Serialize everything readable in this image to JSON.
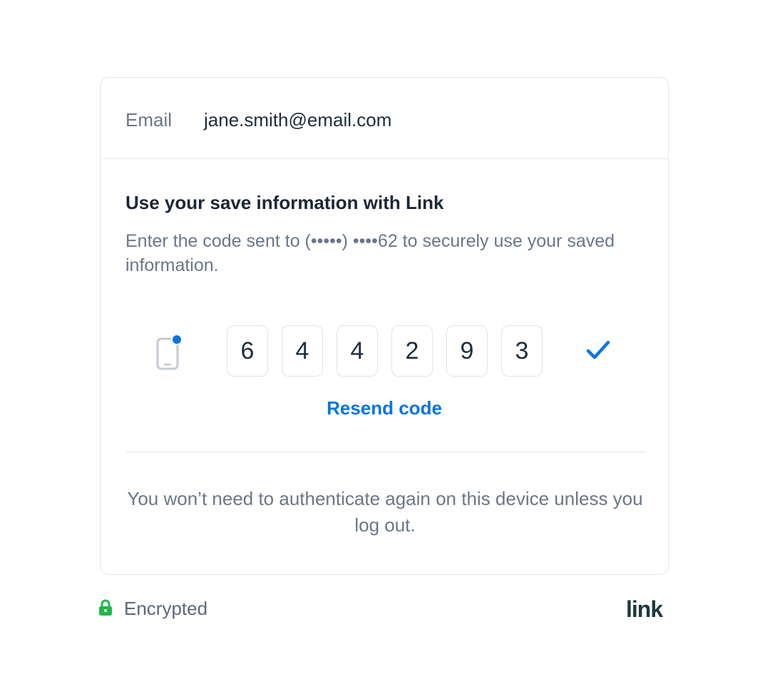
{
  "email": {
    "label": "Email",
    "value": "jane.smith@email.com"
  },
  "verification": {
    "title": "Use your save information with Link",
    "description": "Enter the code sent to (•••••) ••••62 to securely use your saved information.",
    "code_digits": [
      "6",
      "4",
      "4",
      "2",
      "9",
      "3"
    ],
    "resend_label": "Resend code",
    "note": "You won’t need to authenticate again on this device unless you log out."
  },
  "footer": {
    "encrypted_label": "Encrypted",
    "brand": "link"
  },
  "colors": {
    "accent": "#0a74e0",
    "secure_green": "#1fb84a",
    "brand": "#1c3a3a"
  },
  "icons": {
    "phone": "phone-notification-icon",
    "check": "checkmark-icon",
    "lock": "lock-icon"
  }
}
